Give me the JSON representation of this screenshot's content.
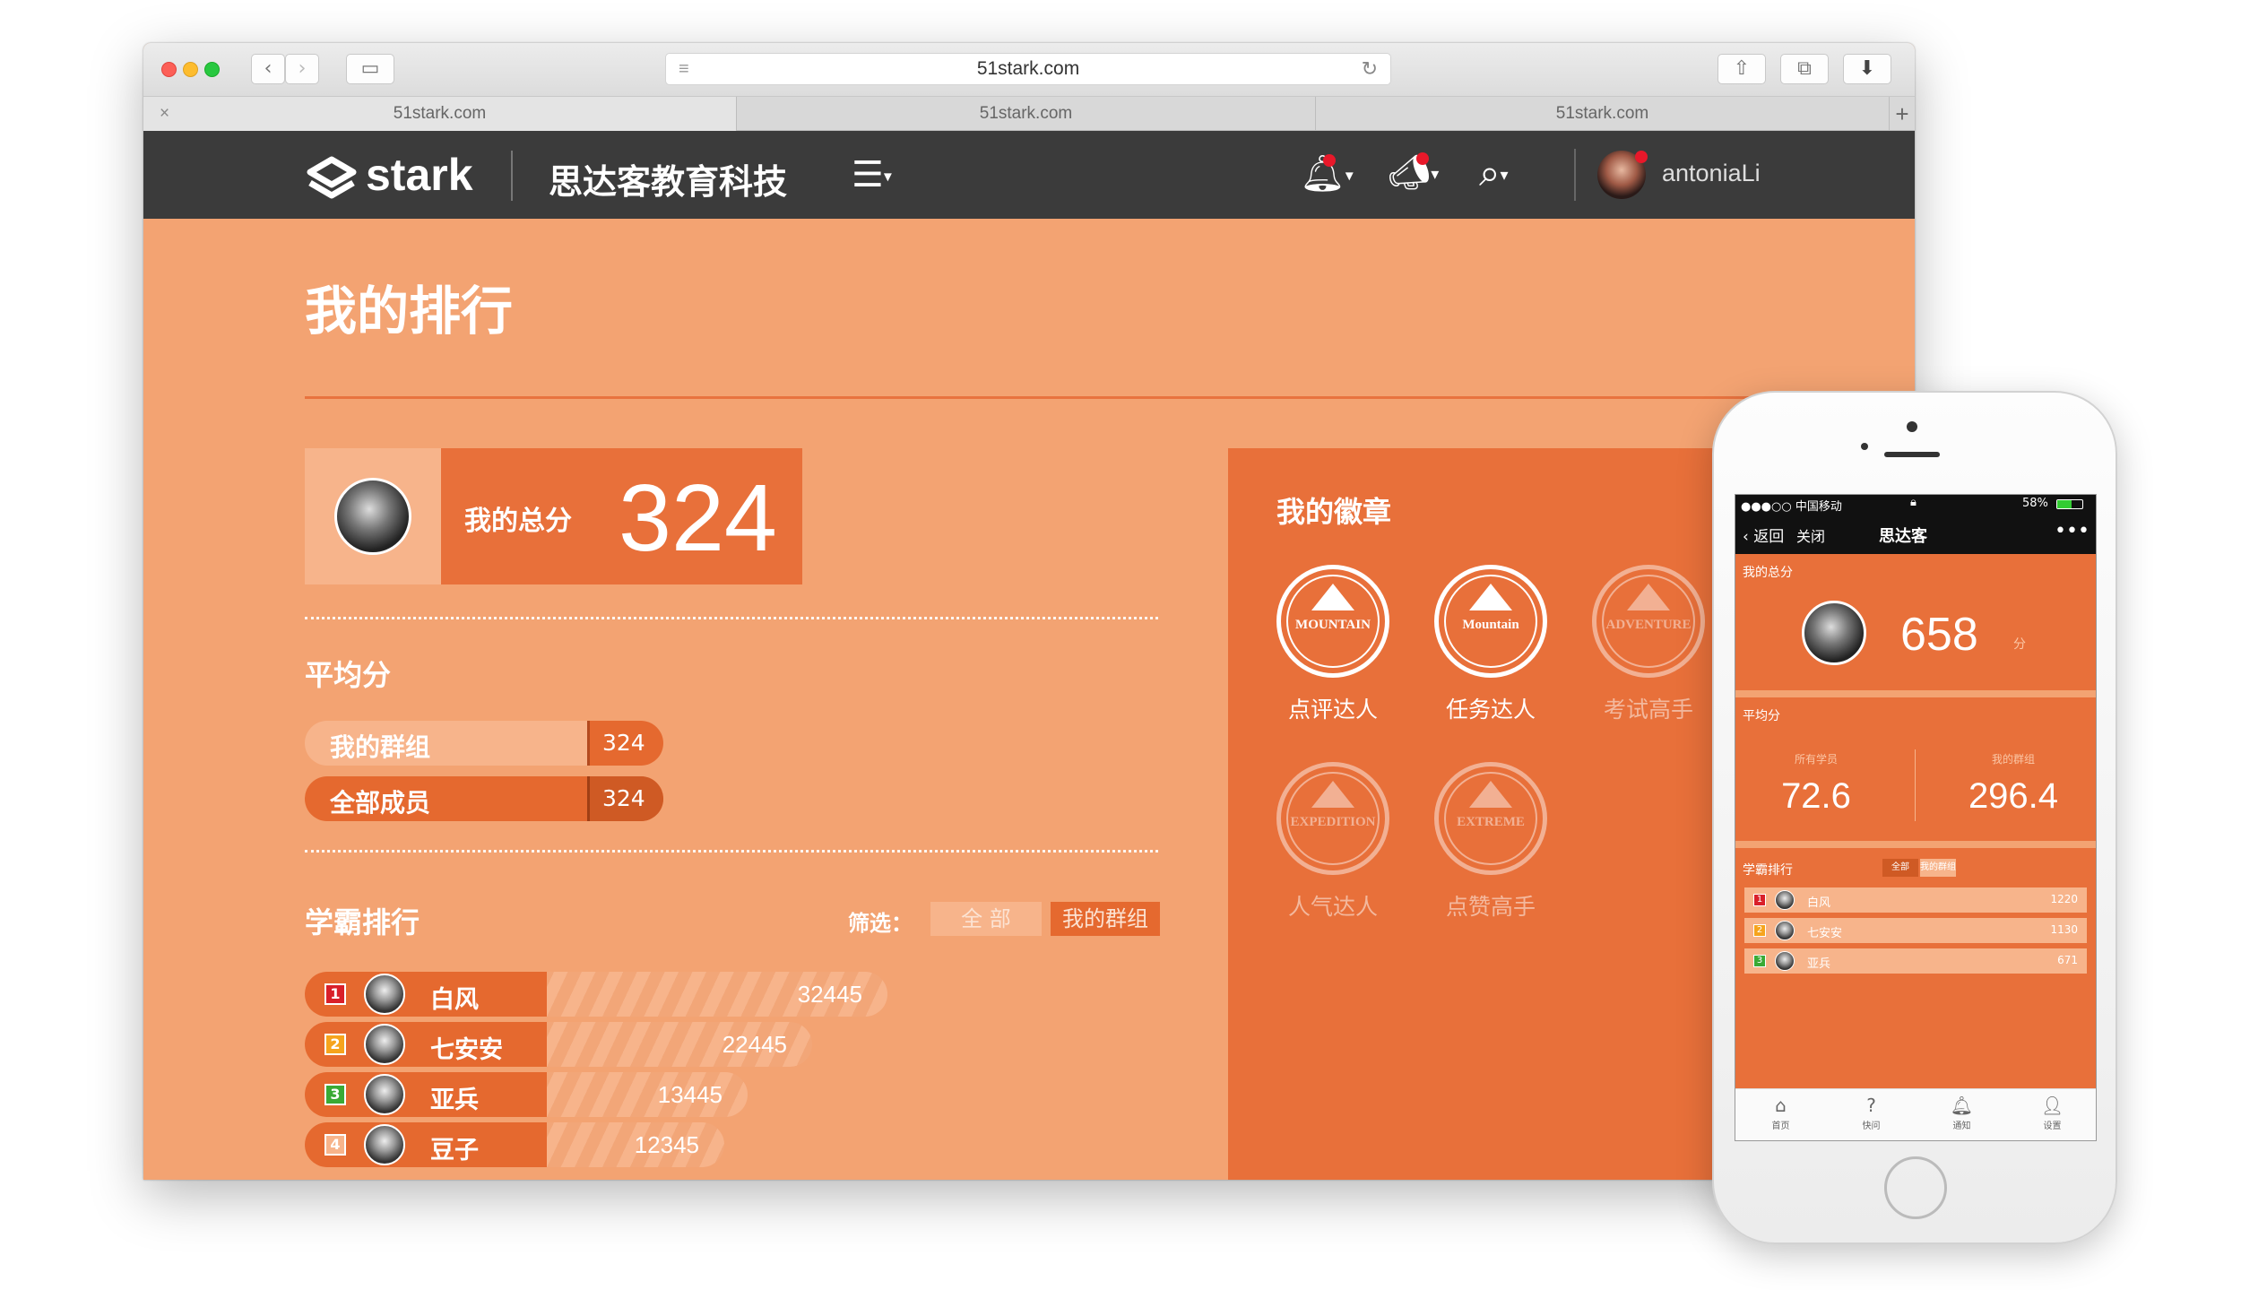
{
  "browser": {
    "url": "51stark.com",
    "tabs": [
      "51stark.com",
      "51stark.com",
      "51stark.com"
    ],
    "tab_close": "×",
    "new_tab": "+"
  },
  "nav": {
    "logo": "stark",
    "org_name": "思达客教育科技",
    "username": "antoniaLi"
  },
  "page": {
    "title": "我的排行",
    "total_label": "我的总分",
    "total_value": "324",
    "avg_title": "平均分",
    "avg": [
      {
        "label": "我的群组",
        "value": "324"
      },
      {
        "label": "全部成员",
        "value": "324"
      }
    ],
    "rank_title": "学霸排行",
    "filter_label": "筛选：",
    "filter_options": [
      "全 部",
      "我的群组"
    ],
    "ranking": [
      {
        "rank": "1",
        "name": "白风",
        "score": "32445",
        "fill": 1.0,
        "color": "#d9202a"
      },
      {
        "rank": "2",
        "name": "七安安",
        "score": "22445",
        "fill": 0.87,
        "color": "#f6a41d"
      },
      {
        "rank": "3",
        "name": "亚兵",
        "score": "13445",
        "fill": 0.76,
        "color": "#3aaa35"
      },
      {
        "rank": "4",
        "name": "豆子",
        "score": "12345",
        "fill": 0.72,
        "color": "#f7b48b"
      }
    ],
    "badges_title": "我的徽章",
    "badges": [
      {
        "name": "点评达人",
        "emblem": "MOUNTAIN",
        "active": true
      },
      {
        "name": "任务达人",
        "emblem": "Mountain",
        "active": true
      },
      {
        "name": "考试高手",
        "emblem": "ADVENTURE",
        "active": false
      },
      {
        "name": "人气达人",
        "emblem": "EXPEDITION",
        "active": false
      },
      {
        "name": "点赞高手",
        "emblem": "EXTREME",
        "active": false
      }
    ]
  },
  "phone": {
    "status": {
      "carrier": "●●●○○ 中国移动",
      "battery": "58%"
    },
    "header": {
      "back": "返回",
      "close": "关闭",
      "title": "思达客",
      "more": "•••"
    },
    "total_label": "我的总分",
    "total_value": "658",
    "total_unit": "分",
    "avg_title": "平均分",
    "avg": [
      {
        "label": "所有学员",
        "value": "72.6"
      },
      {
        "label": "我的群组",
        "value": "296.4"
      }
    ],
    "rank_title": "学霸排行",
    "filter_options": [
      "全部",
      "我的群组"
    ],
    "ranking": [
      {
        "rank": "1",
        "name": "白风",
        "score": "1220",
        "color": "#d9202a"
      },
      {
        "rank": "2",
        "name": "七安安",
        "score": "1130",
        "color": "#f6a41d"
      },
      {
        "rank": "3",
        "name": "亚兵",
        "score": "671",
        "color": "#3aaa35"
      }
    ],
    "tabbar": [
      "首页",
      "快问",
      "通知",
      "设置"
    ]
  }
}
